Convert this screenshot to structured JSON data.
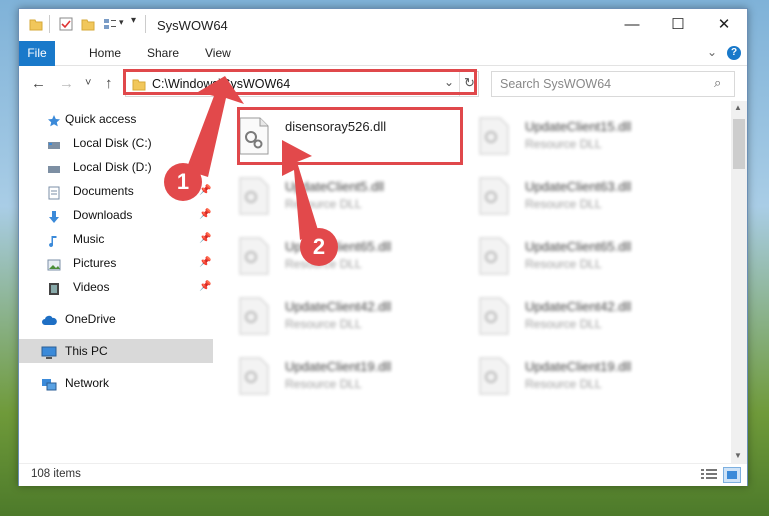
{
  "window": {
    "title": "SysWOW64",
    "minimize_glyph": "—",
    "maximize_glyph": "☐",
    "close_glyph": "✕"
  },
  "ribbon": {
    "tabs": [
      "File",
      "Home",
      "Share",
      "View"
    ],
    "help_glyph": "?",
    "expand_glyph": "⌄"
  },
  "address": {
    "path": "C:\\Windows\\SysWOW64",
    "search_placeholder": "Search SysWOW64",
    "refresh_glyph": "↻",
    "dropdown_glyph": "⌄",
    "back_glyph": "←",
    "forward_glyph": "→",
    "recent_glyph": "˅",
    "up_glyph": "↑",
    "search_glyph": "⌕"
  },
  "sidebar": {
    "items": [
      {
        "label": "Quick access",
        "icon": "star-icon",
        "pinned": false
      },
      {
        "label": "Local Disk (C:)",
        "icon": "drive-icon",
        "pinned": true
      },
      {
        "label": "Local Disk (D:)",
        "icon": "drive-icon",
        "pinned": true
      },
      {
        "label": "Documents",
        "icon": "documents-icon",
        "pinned": true
      },
      {
        "label": "Downloads",
        "icon": "download-icon",
        "pinned": true
      },
      {
        "label": "Music",
        "icon": "music-icon",
        "pinned": true
      },
      {
        "label": "Pictures",
        "icon": "pictures-icon",
        "pinned": true
      },
      {
        "label": "Videos",
        "icon": "videos-icon",
        "pinned": true
      },
      {
        "label": "OneDrive",
        "icon": "cloud-icon",
        "pinned": false
      },
      {
        "label": "This PC",
        "icon": "computer-icon",
        "pinned": false,
        "selected": true
      },
      {
        "label": "Network",
        "icon": "network-icon",
        "pinned": false
      }
    ],
    "pin_glyph": "📌"
  },
  "files": [
    {
      "name": "disensoray526.dll",
      "type": "",
      "highlighted": true
    },
    {
      "name": "UpdateClient15.dll",
      "type": "Resource DLL"
    },
    {
      "name": "UpdateClient5.dll",
      "type": "Resource DLL"
    },
    {
      "name": "UpdateClient63.dll",
      "type": "Resource DLL"
    },
    {
      "name": "UpdateClient65.dll",
      "type": "Resource DLL"
    },
    {
      "name": "UpdateClient65.dll",
      "type": "Resource DLL"
    },
    {
      "name": "UpdateClient42.dll",
      "type": "Resource DLL"
    },
    {
      "name": "UpdateClient42.dll",
      "type": "Resource DLL"
    },
    {
      "name": "UpdateClient19.dll",
      "type": "Resource DLL"
    },
    {
      "name": "UpdateClient19.dll",
      "type": "Resource DLL"
    }
  ],
  "status": {
    "item_count": "108 items"
  },
  "annotations": {
    "step1": "1",
    "step2": "2",
    "color": "#e0484b"
  },
  "colors": {
    "accent": "#1979ca",
    "highlight": "#e0484b"
  }
}
